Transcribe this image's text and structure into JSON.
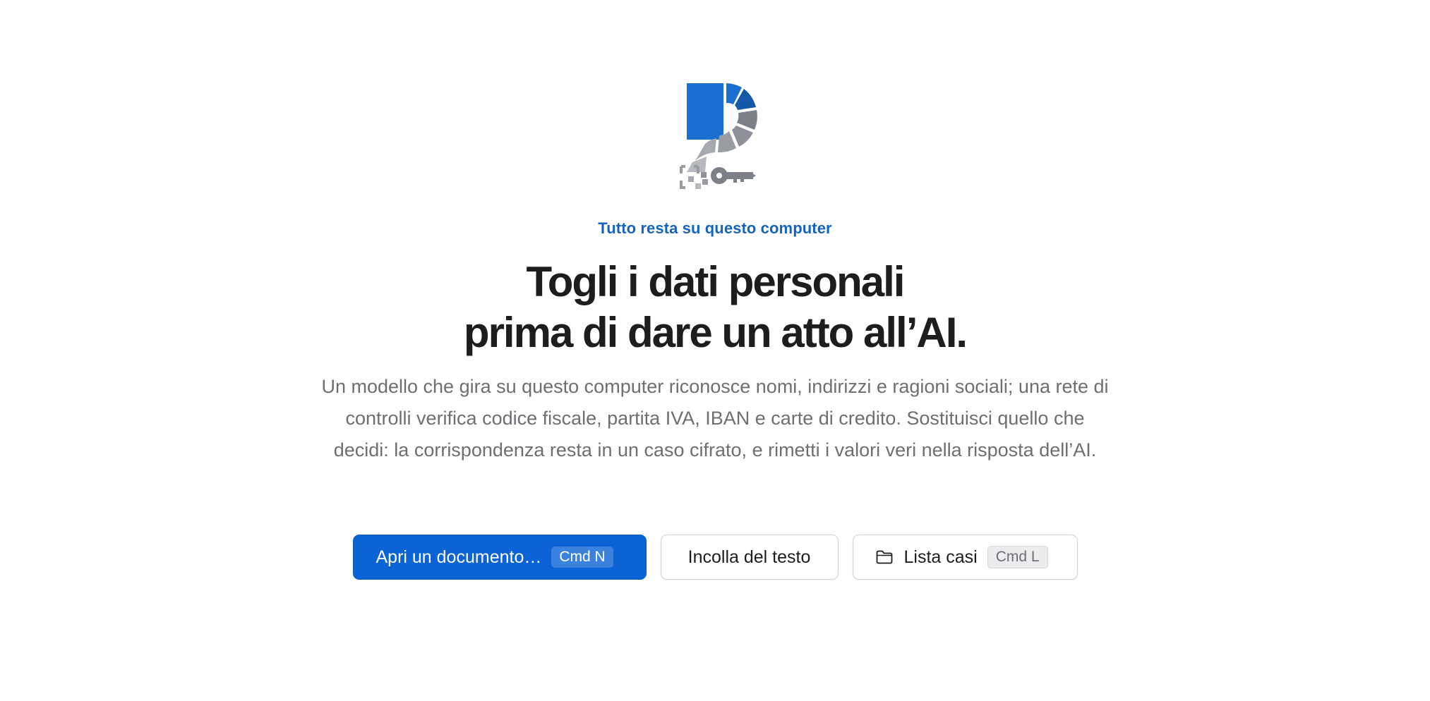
{
  "hero": {
    "logo_icon": "redaction-logo-icon",
    "eyebrow": "Tutto resta su questo computer",
    "headline_line1": "Togli i dati personali",
    "headline_line2": "prima di dare un atto all’AI.",
    "description": "Un modello che gira su questo computer riconosce nomi, indirizzi e ragioni sociali; una rete di controlli verifica codice fiscale, partita IVA, IBAN e carte di credito. Sostituisci quello che decidi: la corrispondenza resta in un caso cifrato, e rimetti i valori veri nella risposta dell’AI."
  },
  "actions": {
    "open_label": "Apri un documento…",
    "open_shortcut": "Cmd N",
    "paste_label": "Incolla del testo",
    "cases_label": "Lista casi",
    "cases_shortcut": "Cmd L",
    "cases_icon": "folder-icon"
  },
  "colors": {
    "accent": "#0b63d6",
    "eyebrow": "#1565c0",
    "headline": "#1d1d1f",
    "body": "#6e6e73",
    "logo_blue": "#1a6fd0",
    "logo_gray": "#8e9099"
  }
}
